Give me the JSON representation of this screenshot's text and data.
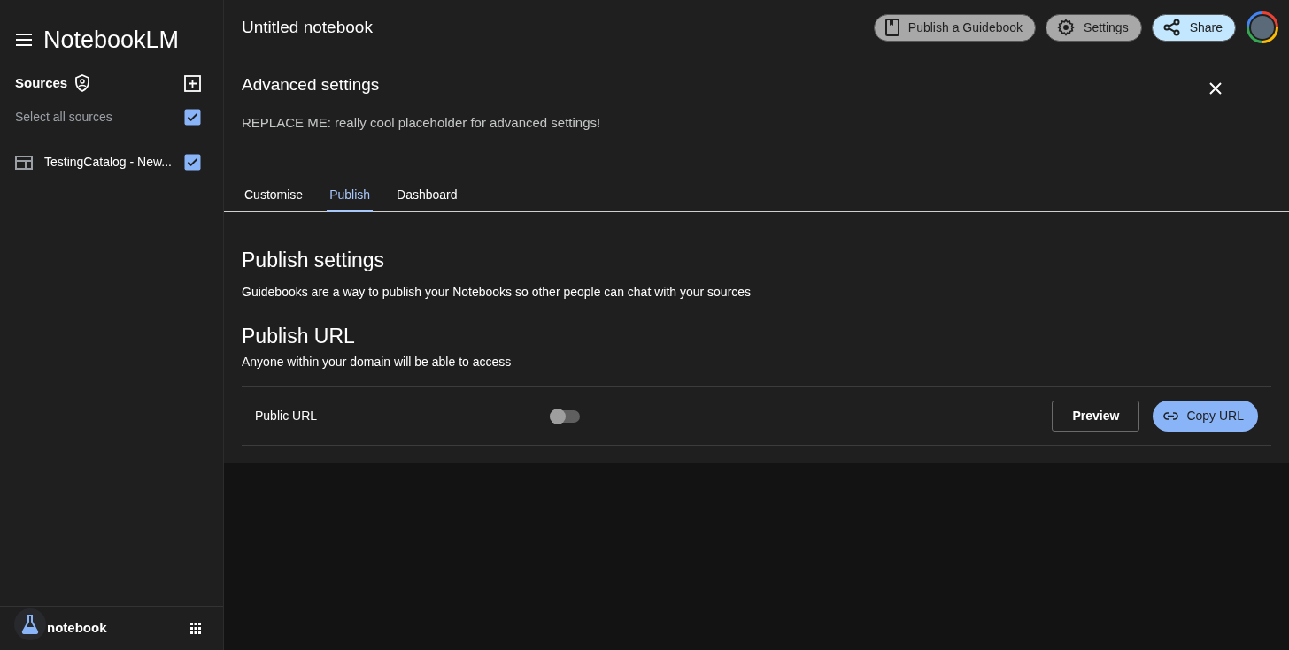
{
  "app": {
    "title": "NotebookLM"
  },
  "sources": {
    "heading": "Sources",
    "select_all": {
      "label": "Select all sources",
      "checked": true
    },
    "items": [
      {
        "title": "TestingCatalog - New...",
        "checked": true
      }
    ]
  },
  "footer": {
    "label": "notebook"
  },
  "header": {
    "title": "Untitled notebook",
    "buttons": [
      {
        "label": "Publish a Guidebook",
        "kind": "guidebook"
      },
      {
        "label": "Settings",
        "kind": "settings"
      },
      {
        "label": "Share",
        "kind": "share"
      }
    ]
  },
  "panel": {
    "title": "Advanced settings",
    "description": "REPLACE ME: really cool placeholder for advanced settings!"
  },
  "tabs": [
    {
      "label": "Customise",
      "selected": false
    },
    {
      "label": "Publish",
      "selected": true
    },
    {
      "label": "Dashboard",
      "selected": false
    }
  ],
  "publish_settings": {
    "title": "Publish settings",
    "description": "Guidebooks are a way to publish your Notebooks so other people can chat with your sources"
  },
  "publish_url": {
    "title": "Publish URL",
    "description": "Anyone within your domain will be able to access",
    "row": {
      "label": "Public URL",
      "on": false,
      "buttons": [
        {
          "label": "Preview",
          "kind": "outlined"
        },
        {
          "label": "Copy URL",
          "kind": "filled"
        }
      ]
    }
  }
}
